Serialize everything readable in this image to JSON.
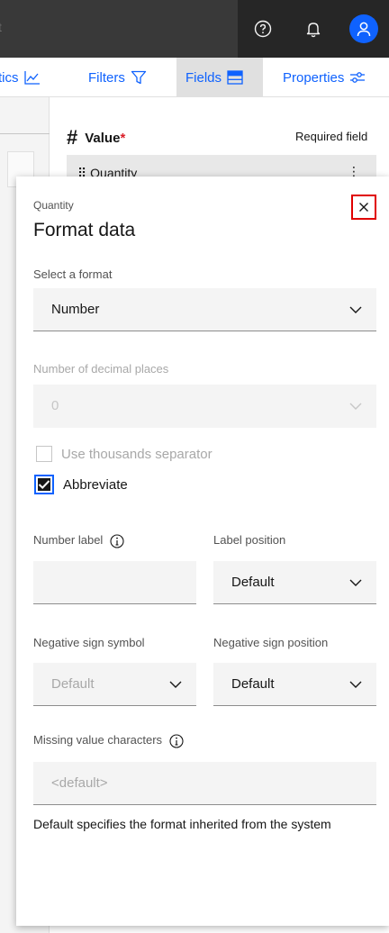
{
  "topbar": {
    "search_fragment": "t",
    "help_icon": "help-icon",
    "notifications_icon": "bell-icon",
    "user_icon": "user-icon"
  },
  "toolbar": {
    "analytics_label": "tics",
    "filters_label": "Filters",
    "fields_label": "Fields",
    "properties_label": "Properties"
  },
  "background": {
    "value_label": "Value",
    "required_marker": "*",
    "required_field": "Required field",
    "chip_label": "Quantity"
  },
  "panel": {
    "subtitle": "Quantity",
    "title": "Format data",
    "format": {
      "label": "Select a format",
      "value": "Number"
    },
    "decimals": {
      "label": "Number of decimal places",
      "value": "0"
    },
    "thousands": {
      "label": "Use thousands separator",
      "checked": false
    },
    "abbreviate": {
      "label": "Abbreviate",
      "checked": true
    },
    "number_label": {
      "label": "Number label",
      "value": ""
    },
    "label_position": {
      "label": "Label position",
      "value": "Default"
    },
    "neg_symbol": {
      "label": "Negative sign symbol",
      "value": "Default"
    },
    "neg_position": {
      "label": "Negative sign position",
      "value": "Default"
    },
    "missing": {
      "label": "Missing value characters",
      "placeholder": "<default>"
    },
    "helper_text": "Default specifies the format inherited from the system"
  },
  "colors": {
    "accent": "#0f62fe",
    "highlight": "#e00000",
    "topbar": "#262626"
  }
}
